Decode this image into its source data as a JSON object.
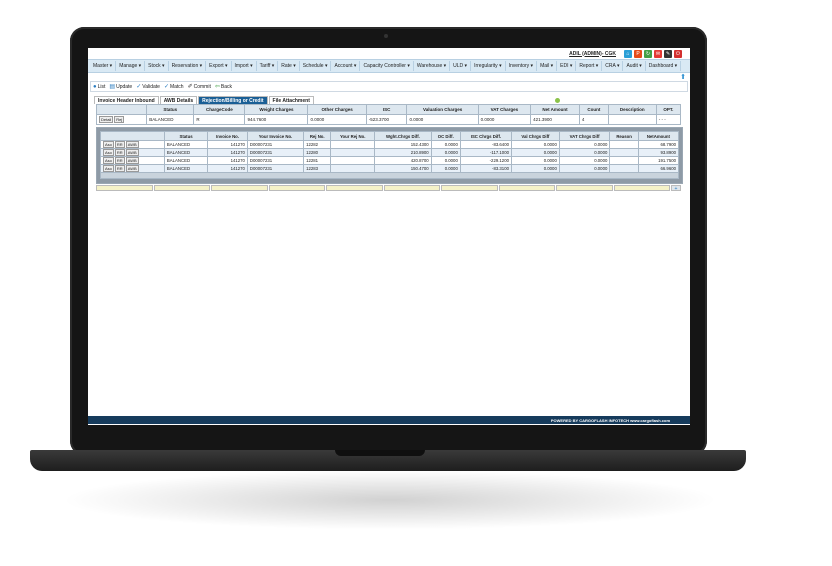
{
  "topbar": {
    "user": "ADIL (ADMIN)- CGK",
    "icons": [
      {
        "name": "home-icon",
        "color": "#2a9fd6",
        "glyph": "⌂"
      },
      {
        "name": "power-icon",
        "color": "#e64a19",
        "glyph": "P"
      },
      {
        "name": "refresh-icon",
        "color": "#43a047",
        "glyph": "↻"
      },
      {
        "name": "mail-icon",
        "color": "#e53935",
        "glyph": "✉"
      },
      {
        "name": "tools-icon",
        "color": "#333333",
        "glyph": "✎"
      },
      {
        "name": "logout-icon",
        "color": "#d32f2f",
        "glyph": "⏻"
      }
    ]
  },
  "menu": [
    "Master ▾",
    "Manage ▾",
    "Stock ▾",
    "Reservation ▾",
    "Export ▾",
    "Import ▾",
    "Tariff ▾",
    "Rate ▾",
    "Schedule ▾",
    "Account ▾",
    "Capacity Controller ▾",
    "Warehouse ▾",
    "ULD ▾",
    "Irregularity ▾",
    "Inventory ▾",
    "Mail ▾",
    "EDI ▾",
    "Report ▾",
    "CRA ▾",
    "Audit ▾",
    "Dashboard ▾"
  ],
  "toolbar": {
    "list": "List",
    "update": "Update",
    "validate": "Validate",
    "match": "Match",
    "commit": "Commit",
    "back": "Back"
  },
  "tabs": [
    "Invoice Header Inbound",
    "AWB Details",
    "Rejection/Billing or Credit",
    "File Attachment"
  ],
  "summary": {
    "headers": [
      "",
      "Status",
      "ChargeCode",
      "Weight Charges",
      "Other Charges",
      "ISC",
      "Valuation Charges",
      "VAT Charges",
      "Net Amount",
      "Count",
      "Description",
      "OPT."
    ],
    "row": {
      "btn_detail": "Detail",
      "btn_rej": "Rej",
      "status": "BALANCED",
      "charge_code": "R",
      "weight": "944.7600",
      "other": "0.0000",
      "isc": "-523.3700",
      "valuation": "0.0000",
      "vat": "0.0000",
      "net": "421.3900",
      "count": "4",
      "description": "",
      "opt": "- - -"
    }
  },
  "detail": {
    "headers": [
      "",
      "Status",
      "Invoice No.",
      "Your Invoice No.",
      "Rej No.",
      "Your Rej No.",
      "Wght.Chrgs Diff.",
      "OC Diff.",
      "ISC Chrgs Diff.",
      "Val Chrgs Diff",
      "VAT Chrgs Diff",
      "Reason",
      "NetAmount"
    ],
    "btns": [
      "Aso",
      "RR",
      "AWB"
    ],
    "rows": [
      {
        "status": "BALANCED",
        "invoice": "141270",
        "your_invoice": "D00007231",
        "rej": "12282",
        "your_rej": "",
        "wght": "152.4300",
        "oc": "0.0000",
        "isc": "-83.6400",
        "val": "0.0000",
        "vat": "0.0000",
        "reason": "",
        "net": "68.7900"
      },
      {
        "status": "BALANCED",
        "invoice": "141270",
        "your_invoice": "D00007231",
        "rej": "12280",
        "your_rej": "",
        "wght": "210.8900",
        "oc": "0.0000",
        "isc": "-117.1000",
        "val": "0.0000",
        "vat": "0.0000",
        "reason": "",
        "net": "93.8900"
      },
      {
        "status": "BALANCED",
        "invoice": "141270",
        "your_invoice": "D00007231",
        "rej": "12281",
        "your_rej": "",
        "wght": "420.8700",
        "oc": "0.0000",
        "isc": "-229.1200",
        "val": "0.0000",
        "vat": "0.0000",
        "reason": "",
        "net": "191.7500"
      },
      {
        "status": "BALANCED",
        "invoice": "141270",
        "your_invoice": "D00007231",
        "rej": "12283",
        "your_rej": "",
        "wght": "150.4700",
        "oc": "0.0000",
        "isc": "-83.3100",
        "val": "0.0000",
        "vat": "0.0000",
        "reason": "",
        "net": "66.9600"
      }
    ]
  },
  "footer": "POWERED BY CARGOFLASH INFOTECH www.cargoflash.com"
}
